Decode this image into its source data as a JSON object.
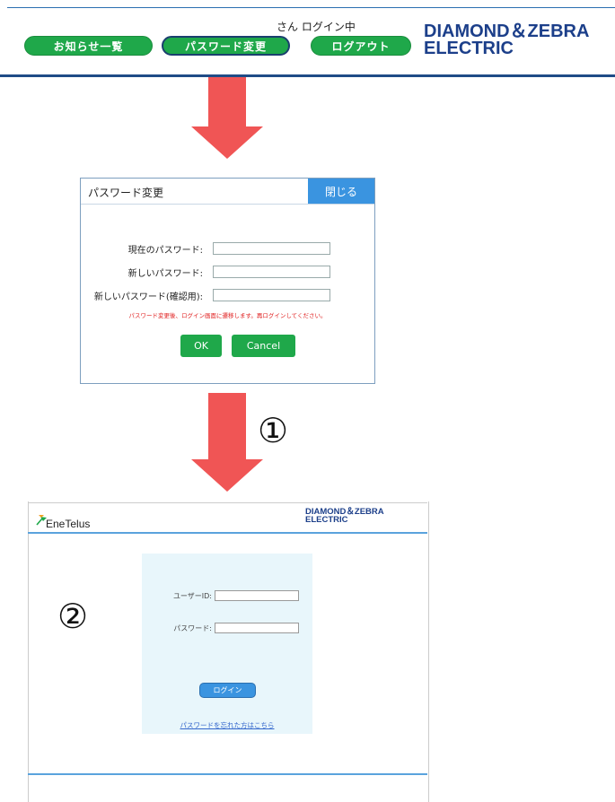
{
  "header": {
    "logged_in": "さん ログイン中",
    "nav": [
      "お知らせ一覧",
      "パスワード変更",
      "ログアウト"
    ],
    "brand_line1": "DIAMOND＆ZEBRA",
    "brand_line2": "ELECTRIC"
  },
  "dialog": {
    "title": "パスワード変更",
    "close": "閉じる",
    "fields": [
      "現在のパスワード:",
      "新しいパスワード:",
      "新しいパスワード(確認用):"
    ],
    "notice": "パスワード変更後、ログイン画面に遷移します。再ログインしてください。",
    "ok": "OK",
    "cancel": "Cancel"
  },
  "steps": [
    "①",
    "②"
  ],
  "login": {
    "logo": "EneTelus",
    "brand_line1": "DIAMOND＆ZEBRA",
    "brand_line2": "ELECTRIC",
    "user_label": "ユーザーID:",
    "pass_label": "パスワード:",
    "login_button": "ログイン",
    "forgot": "パスワードを忘れた方はこちら"
  },
  "colors": {
    "accent_green": "#1fa84a",
    "arrow_red": "#f05555",
    "brand_blue": "#1c3f8a",
    "button_blue": "#3a94e0"
  }
}
